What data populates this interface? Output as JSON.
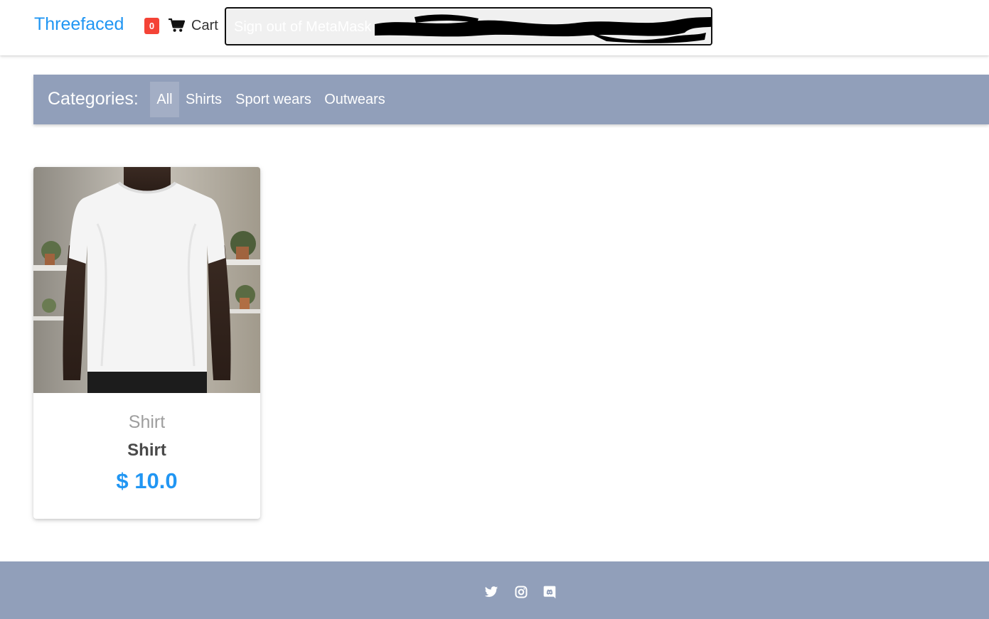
{
  "header": {
    "brand": "Threefaced",
    "cart_count": "0",
    "cart_label": "Cart",
    "signout_label": "Sign out of MetaMask"
  },
  "categories": {
    "title": "Categories:",
    "items": [
      {
        "label": "All",
        "active": true
      },
      {
        "label": "Shirts",
        "active": false
      },
      {
        "label": "Sport wears",
        "active": false
      },
      {
        "label": "Outwears",
        "active": false
      }
    ]
  },
  "products": [
    {
      "category": "Shirt",
      "name": "Shirt",
      "price": "$ 10.0"
    }
  ],
  "footer": {
    "icons": [
      "twitter-icon",
      "instagram-icon",
      "discord-icon"
    ]
  },
  "colors": {
    "brand": "#2196f3",
    "badge": "#f44336",
    "bar": "#919fba",
    "price": "#2196f3"
  }
}
